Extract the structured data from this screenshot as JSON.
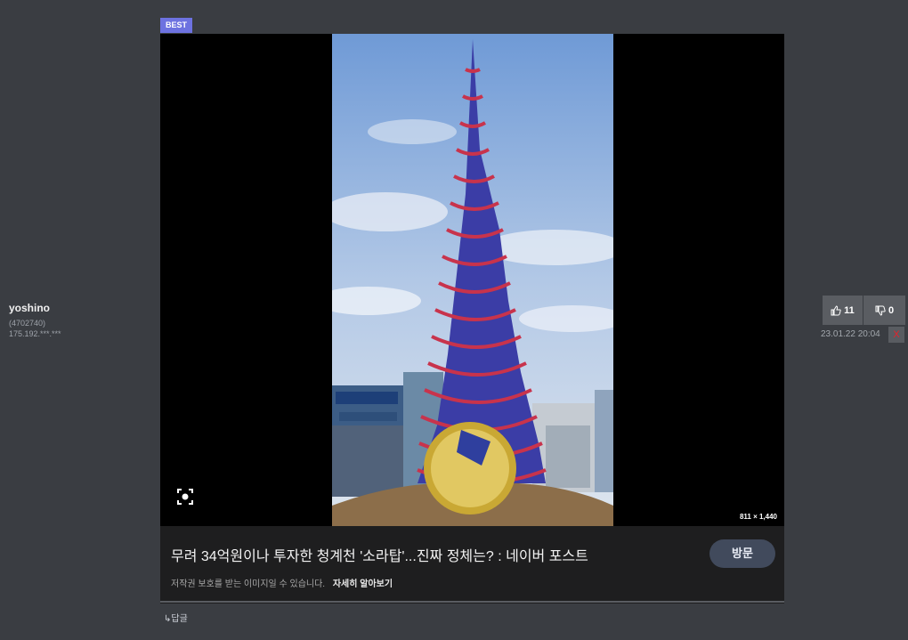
{
  "user": {
    "name": "yoshino",
    "id": "(4702740)",
    "ip": "175.192.***.***"
  },
  "badge": "BEST",
  "card": {
    "image_dims": "811 × 1,440",
    "title": "무려 34억원이나 투자한 청계천 '소라탑'...진짜 정체는? : 네이버 포스트",
    "visit_label": "방문",
    "copyright_text": "저작권 보호를 받는 이미지일 수 있습니다.",
    "learn_more": "자세히 알아보기",
    "lens_icon": "lens-icon"
  },
  "reply_label": "↳답글",
  "votes": {
    "up_count": "11",
    "down_count": "0"
  },
  "timestamp": "23.01.22 20:04",
  "delete_label": "X",
  "colors": {
    "page_bg": "#3a3d42",
    "badge_bg": "#6d72e0",
    "card_bg": "#1e1e1f",
    "visit_btn_bg": "#414a5c",
    "vote_bg": "#5a5d62",
    "delete_color": "#e8212a"
  }
}
